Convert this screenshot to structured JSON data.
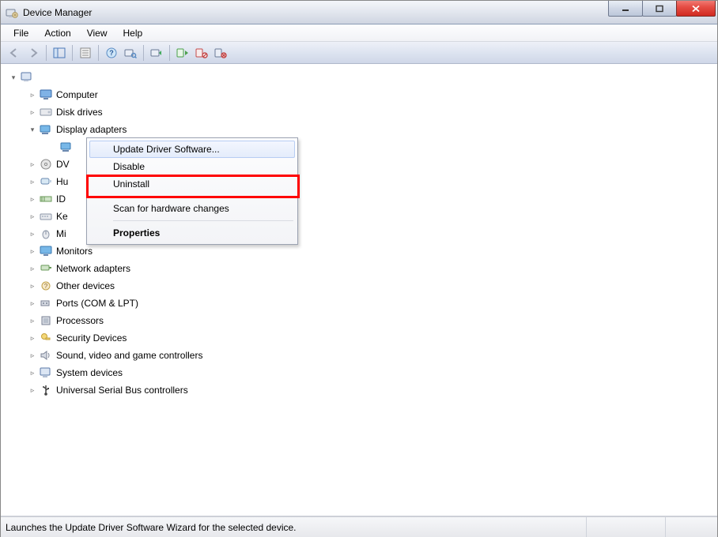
{
  "window": {
    "title": "Device Manager"
  },
  "menu": {
    "file": "File",
    "action": "Action",
    "view": "View",
    "help": "Help"
  },
  "tree": {
    "root": "",
    "items": [
      {
        "label": "Computer"
      },
      {
        "label": "Disk drives"
      },
      {
        "label": "Display adapters"
      },
      {
        "label": "DVD/CD-ROM drives",
        "truncated": "DV"
      },
      {
        "label": "Human Interface Devices",
        "truncated": "Hu"
      },
      {
        "label": "IDE ATA/ATAPI controllers",
        "truncated": "ID"
      },
      {
        "label": "Keyboards",
        "truncated": "Ke"
      },
      {
        "label": "Mice and other pointing devices",
        "truncated": "Mi"
      },
      {
        "label": "Monitors"
      },
      {
        "label": "Network adapters"
      },
      {
        "label": "Other devices"
      },
      {
        "label": "Ports (COM & LPT)"
      },
      {
        "label": "Processors"
      },
      {
        "label": "Security Devices"
      },
      {
        "label": "Sound, video and game controllers"
      },
      {
        "label": "System devices"
      },
      {
        "label": "Universal Serial Bus controllers"
      }
    ]
  },
  "context_menu": {
    "update": "Update Driver Software...",
    "disable": "Disable",
    "uninstall": "Uninstall",
    "scan": "Scan for hardware changes",
    "properties": "Properties"
  },
  "status": {
    "text": "Launches the Update Driver Software Wizard for the selected device."
  }
}
